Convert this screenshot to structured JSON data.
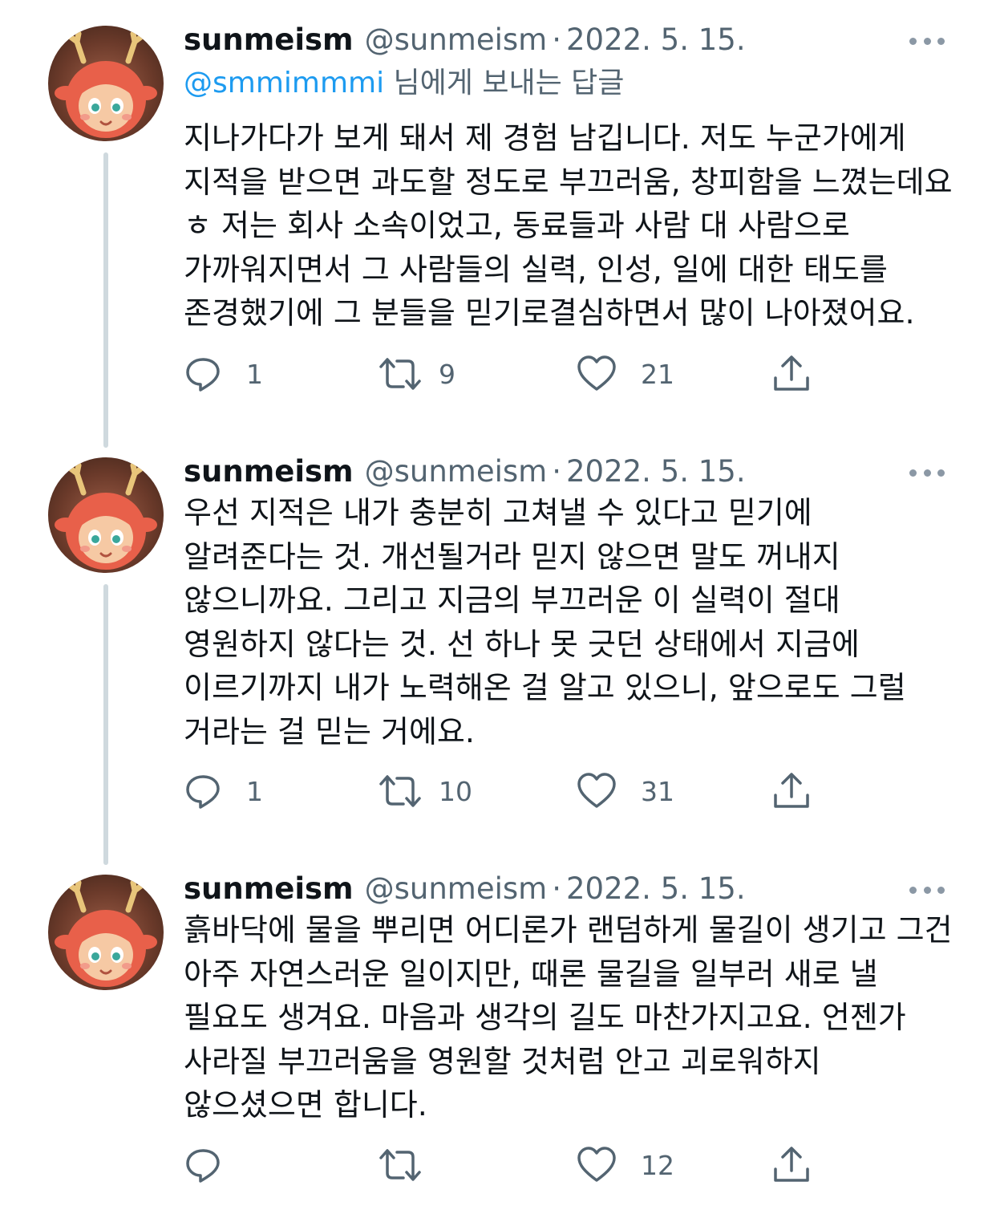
{
  "tweets": [
    {
      "name": "sunmeism",
      "handle": "@sunmeism",
      "separator": "·",
      "date": "2022. 5. 15.",
      "replying_to": {
        "mention": "@smmimmmi",
        "suffix": " 님에게 보내는 답글"
      },
      "text": "지나가다가 보게 돼서 제 경험 남깁니다. 저도 누군가에게 지적을 받으면 과도할 정도로 부끄러움, 창피함을 느꼈는데요 ㅎ 저는 회사 소속이었고, 동료들과 사람 대 사람으로 가까워지면서 그 사람들의 실력, 인성, 일에 대한 태도를 존경했기에 그 분들을 믿기로결심하면서 많이 나아졌어요.",
      "replies": "1",
      "retweets": "9",
      "likes": "21"
    },
    {
      "name": "sunmeism",
      "handle": "@sunmeism",
      "separator": "·",
      "date": "2022. 5. 15.",
      "text": "우선 지적은 내가 충분히 고쳐낼 수 있다고 믿기에 알려준다는 것. 개선될거라 믿지 않으면 말도 꺼내지 않으니까요. 그리고 지금의 부끄러운 이 실력이 절대 영원하지 않다는 것. 선 하나 못 긋던 상태에서 지금에 이르기까지 내가 노력해온 걸 알고 있으니, 앞으로도 그럴 거라는 걸 믿는 거에요.",
      "replies": "1",
      "retweets": "10",
      "likes": "31"
    },
    {
      "name": "sunmeism",
      "handle": "@sunmeism",
      "separator": "·",
      "date": "2022. 5. 15.",
      "text": "흙바닥에 물을 뿌리면 어디론가 랜덤하게 물길이 생기고 그건 아주 자연스러운 일이지만, 때론 물길을 일부러 새로 낼 필요도 생겨요. 마음과 생각의 길도 마찬가지고요. 언젠가 사라질 부끄러움을 영원할 것처럼 안고 괴로워하지 않으셨으면 합니다.",
      "replies": "",
      "retweets": "",
      "likes": "12"
    }
  ],
  "icons": {
    "reply": "reply-icon",
    "retweet": "retweet-icon",
    "like": "heart-icon",
    "share": "share-icon",
    "more": "more-icon",
    "avatar": "deer-avatar"
  },
  "colors": {
    "text": "#0f1419",
    "secondary": "#536471",
    "link": "#1d9bf0",
    "thread_line": "#cfd9de"
  }
}
